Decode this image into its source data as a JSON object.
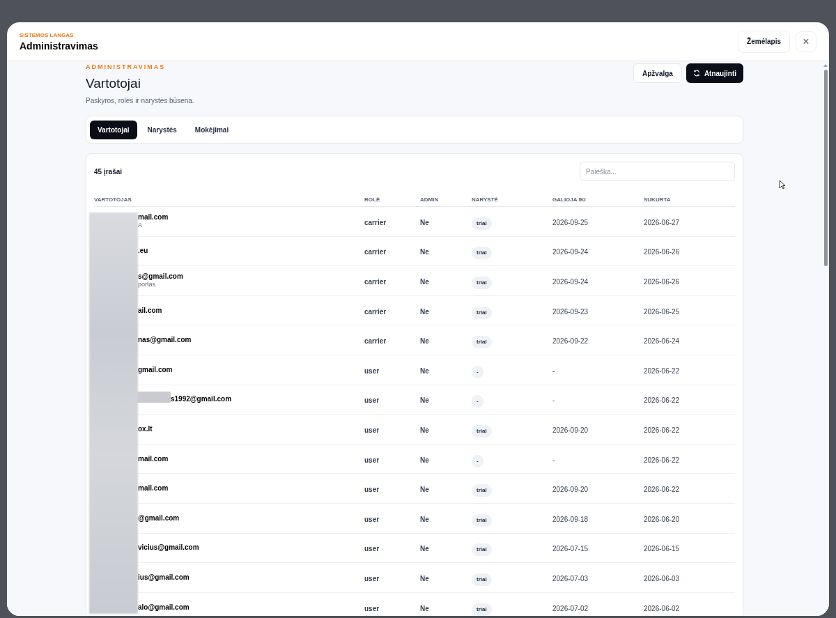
{
  "modal": {
    "eyebrow": "SISTEMOS LANGAS",
    "title": "Administravimas",
    "header_buttons": [
      "Žemėlapis"
    ],
    "close": "×"
  },
  "page": {
    "eyebrow": "ADMINISTRAVIMAS",
    "title": "Vartotojai",
    "subtitle": "Paskyros, rolės ir narystės būsena.",
    "actions": [
      {
        "label": "Apžvalga",
        "kind": "secondary"
      },
      {
        "label": "Atnaujinti",
        "kind": "primary"
      }
    ]
  },
  "tabs": [
    {
      "label": "Vartotojai",
      "selected": true
    },
    {
      "label": "Narystės",
      "selected": false
    },
    {
      "label": "Mokėjimai",
      "selected": false
    }
  ],
  "table": {
    "count": "45 įrašai",
    "search": {
      "placeholder": "Paieška..."
    },
    "columns": [
      "VARTOTOJAS",
      "ROLĖ",
      "ADMIN",
      "NARYSTĖ",
      "GALIOJA IKI",
      "SUKURTA"
    ],
    "rows": [
      {
        "email": "mail.com",
        "note": "A",
        "role": "carrier",
        "admin": "Ne",
        "membership": "trial",
        "valid_until": "2026-09-25",
        "created": "2026-06-27",
        "extra_redaction": false
      },
      {
        "email": ".eu",
        "role": "carrier",
        "admin": "Ne",
        "membership": "trial",
        "valid_until": "2026-09-24",
        "created": "2026-06-26",
        "extra_redaction": false
      },
      {
        "email": "s@gmail.com",
        "note": "portas",
        "role": "carrier",
        "admin": "Ne",
        "membership": "trial",
        "valid_until": "2026-09-24",
        "created": "2026-06-26",
        "extra_redaction": false
      },
      {
        "email": "ail.com",
        "role": "carrier",
        "admin": "Ne",
        "membership": "trial",
        "valid_until": "2026-09-23",
        "created": "2026-06-25",
        "extra_redaction": false
      },
      {
        "email": "nas@gmail.com",
        "role": "carrier",
        "admin": "Ne",
        "membership": "trial",
        "valid_until": "2026-09-22",
        "created": "2026-06-24",
        "extra_redaction": false
      },
      {
        "email": "gmail.com",
        "role": "user",
        "admin": "Ne",
        "membership": "-",
        "valid_until": "-",
        "created": "2026-06-22",
        "extra_redaction": false
      },
      {
        "email": "s1992@gmail.com",
        "role": "user",
        "admin": "Ne",
        "membership": "-",
        "valid_until": "-",
        "created": "2026-06-22",
        "extra_redaction": true
      },
      {
        "email": "ox.lt",
        "role": "user",
        "admin": "Ne",
        "membership": "trial",
        "valid_until": "2026-09-20",
        "created": "2026-06-22",
        "extra_redaction": false
      },
      {
        "email": "mail.com",
        "role": "user",
        "admin": "Ne",
        "membership": "-",
        "valid_until": "-",
        "created": "2026-06-22",
        "extra_redaction": false
      },
      {
        "email": "mail.com",
        "role": "user",
        "admin": "Ne",
        "membership": "trial",
        "valid_until": "2026-09-20",
        "created": "2026-06-22",
        "extra_redaction": false
      },
      {
        "email": "@gmail.com",
        "role": "user",
        "admin": "Ne",
        "membership": "trial",
        "valid_until": "2026-09-18",
        "created": "2026-06-20",
        "extra_redaction": false
      },
      {
        "email": "vicius@gmail.com",
        "role": "user",
        "admin": "Ne",
        "membership": "trial",
        "valid_until": "2026-07-15",
        "created": "2026-06-15",
        "extra_redaction": false
      },
      {
        "email": "ius@gmail.com",
        "role": "user",
        "admin": "Ne",
        "membership": "trial",
        "valid_until": "2026-07-03",
        "created": "2026-06-03",
        "extra_redaction": false
      },
      {
        "email": "alo@gmail.com",
        "role": "user",
        "admin": "Ne",
        "membership": "trial",
        "valid_until": "2026-07-02",
        "created": "2026-06-02",
        "extra_redaction": false
      }
    ]
  }
}
